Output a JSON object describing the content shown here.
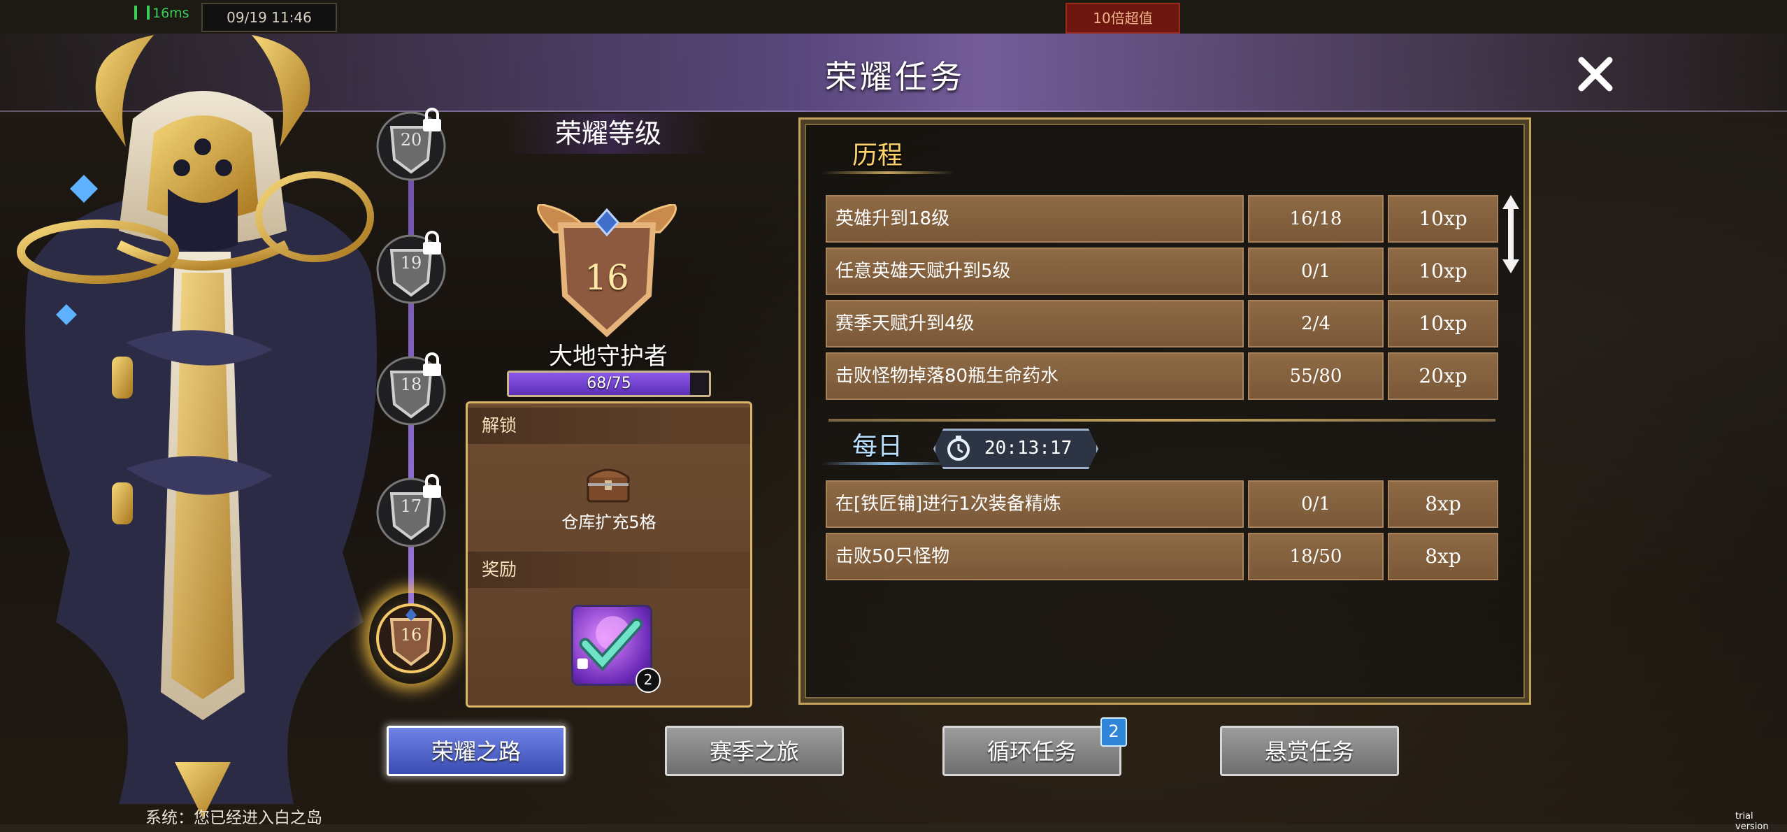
{
  "status": {
    "ping": "16ms",
    "datetime": "09/19 11:46",
    "promo": "10倍超值"
  },
  "title": "荣耀任务",
  "ladder": {
    "levels": [
      {
        "level": "20",
        "locked": true
      },
      {
        "level": "19",
        "locked": true
      },
      {
        "level": "18",
        "locked": true
      },
      {
        "level": "17",
        "locked": true
      },
      {
        "level": "16",
        "locked": false,
        "current": true
      }
    ]
  },
  "glory": {
    "heading": "荣耀等级",
    "level": "16",
    "rank_name": "大地守护者",
    "xp_text": "68/75",
    "xp_fraction": 0.9067
  },
  "reward_panel": {
    "unlock_heading": "解锁",
    "unlock_text": "仓库扩充5格",
    "reward_heading": "奖励",
    "reward_count": "2"
  },
  "progress_section": {
    "title": "历程",
    "tasks": [
      {
        "name": "英雄升到18级",
        "progress": "16/18",
        "xp": "10xp"
      },
      {
        "name": "任意英雄天赋升到5级",
        "progress": "0/1",
        "xp": "10xp"
      },
      {
        "name": "赛季天赋升到4级",
        "progress": "2/4",
        "xp": "10xp"
      },
      {
        "name": "击败怪物掉落80瓶生命药水",
        "progress": "55/80",
        "xp": "20xp"
      }
    ]
  },
  "daily_section": {
    "title": "每日",
    "timer": "20:13:17",
    "tasks": [
      {
        "name": "在[铁匠铺]进行1次装备精炼",
        "progress": "0/1",
        "xp": "8xp"
      },
      {
        "name": "击败50只怪物",
        "progress": "18/50",
        "xp": "8xp"
      }
    ]
  },
  "tabs": [
    {
      "label": "荣耀之路",
      "active": true
    },
    {
      "label": "赛季之旅",
      "active": false
    },
    {
      "label": "循环任务",
      "active": false,
      "badge": "2"
    },
    {
      "label": "悬赏任务",
      "active": false
    }
  ],
  "chat": [
    "系统：您已经进入白之岛"
  ],
  "watermark": "trial version",
  "colors": {
    "accent_gold": "#c4a45d",
    "active_tab": "#3a4cb3",
    "xp_fill": "#8c5ae8",
    "progress_title": "#ffd36a"
  }
}
